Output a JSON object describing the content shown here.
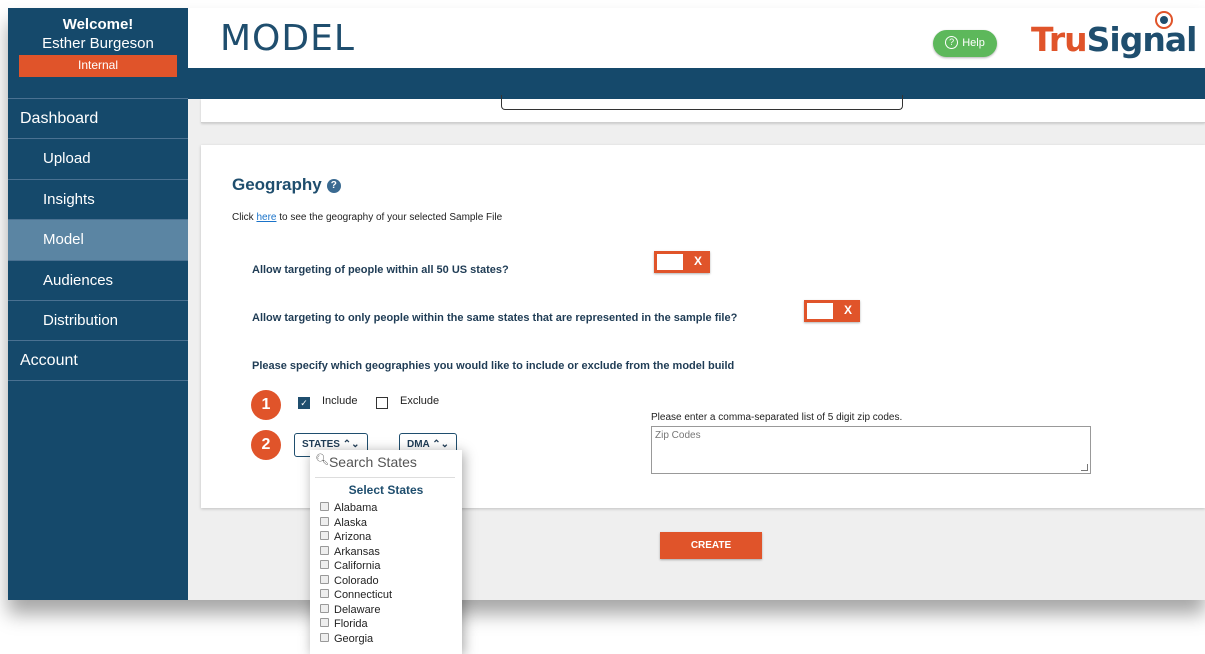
{
  "sidebar": {
    "welcome": "Welcome!",
    "user_name": "Esther Burgeson",
    "role_badge": "Internal",
    "items": [
      {
        "label": "Dashboard"
      },
      {
        "label": "Upload"
      },
      {
        "label": "Insights"
      },
      {
        "label": "Model",
        "active": true
      },
      {
        "label": "Audiences"
      },
      {
        "label": "Distribution"
      },
      {
        "label": "Account"
      }
    ]
  },
  "header": {
    "title": "MODEL",
    "help_label": "Help",
    "logo_part1": "Tru",
    "logo_part2": "Signal"
  },
  "geography": {
    "title": "Geography",
    "note_prefix": "Click ",
    "note_link": "here",
    "note_suffix": " to see the geography of your selected Sample File",
    "q_all_states": "Allow targeting of people within all 50 US states?",
    "q_same_states": "Allow targeting to only people within the same states that are represented in the sample file?",
    "q_specify": "Please specify which geographies you would like to include or exclude from the model build",
    "toggle_off_label": "X",
    "step1": "1",
    "step2": "2",
    "include_label": "Include",
    "exclude_label": "Exclude",
    "include_checked": true,
    "exclude_checked": false,
    "states_button": "STATES",
    "dma_button": "DMA",
    "zip_label": "Please enter a comma-separated list of 5 digit zip codes.",
    "zip_placeholder": "Zip Codes",
    "create_button": "CREATE"
  },
  "states_dropdown": {
    "search_placeholder": "Search States",
    "title": "Select States",
    "options": [
      "Alabama",
      "Alaska",
      "Arizona",
      "Arkansas",
      "California",
      "Colorado",
      "Connecticut",
      "Delaware",
      "Florida",
      "Georgia"
    ]
  },
  "colors": {
    "primary": "#15496b",
    "accent": "#e0542a",
    "active_nav": "#5b85a3",
    "help_green": "#5db85b"
  }
}
